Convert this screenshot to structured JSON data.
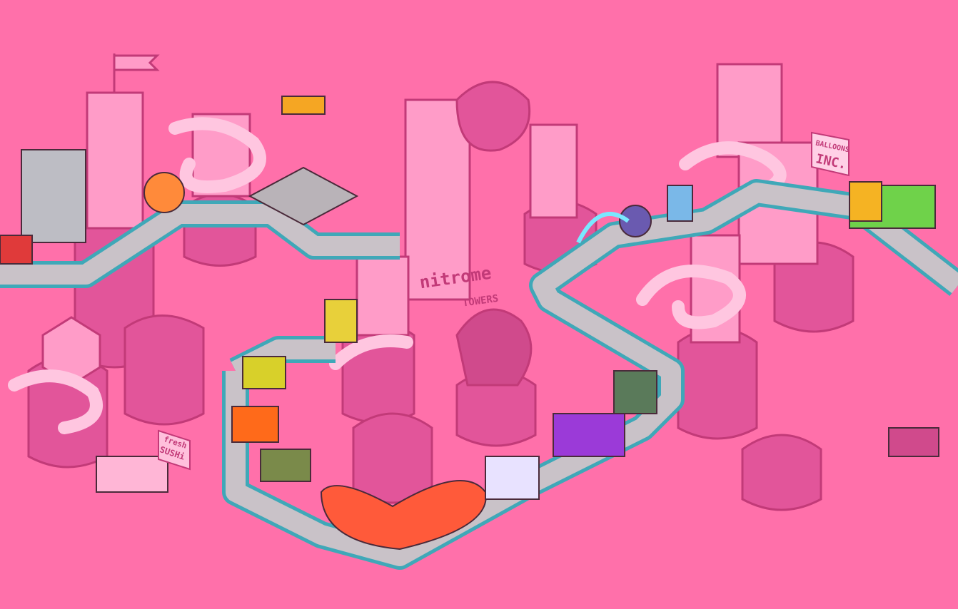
{
  "scene": {
    "background_color": "#ff70aa",
    "road_color": "#3fa8b8",
    "road_surface_color": "#c9c2c8",
    "building_color": "#ff9cc8",
    "pillar_color": "#e2559a"
  },
  "signs": {
    "tower_logo": "nitrome",
    "tower_subtitle": "TOWERS",
    "balloons_line1": "BALLOONS",
    "balloons_line2": "INC.",
    "sushi_line1": "fresh",
    "sushi_line2": "SUSHi"
  }
}
